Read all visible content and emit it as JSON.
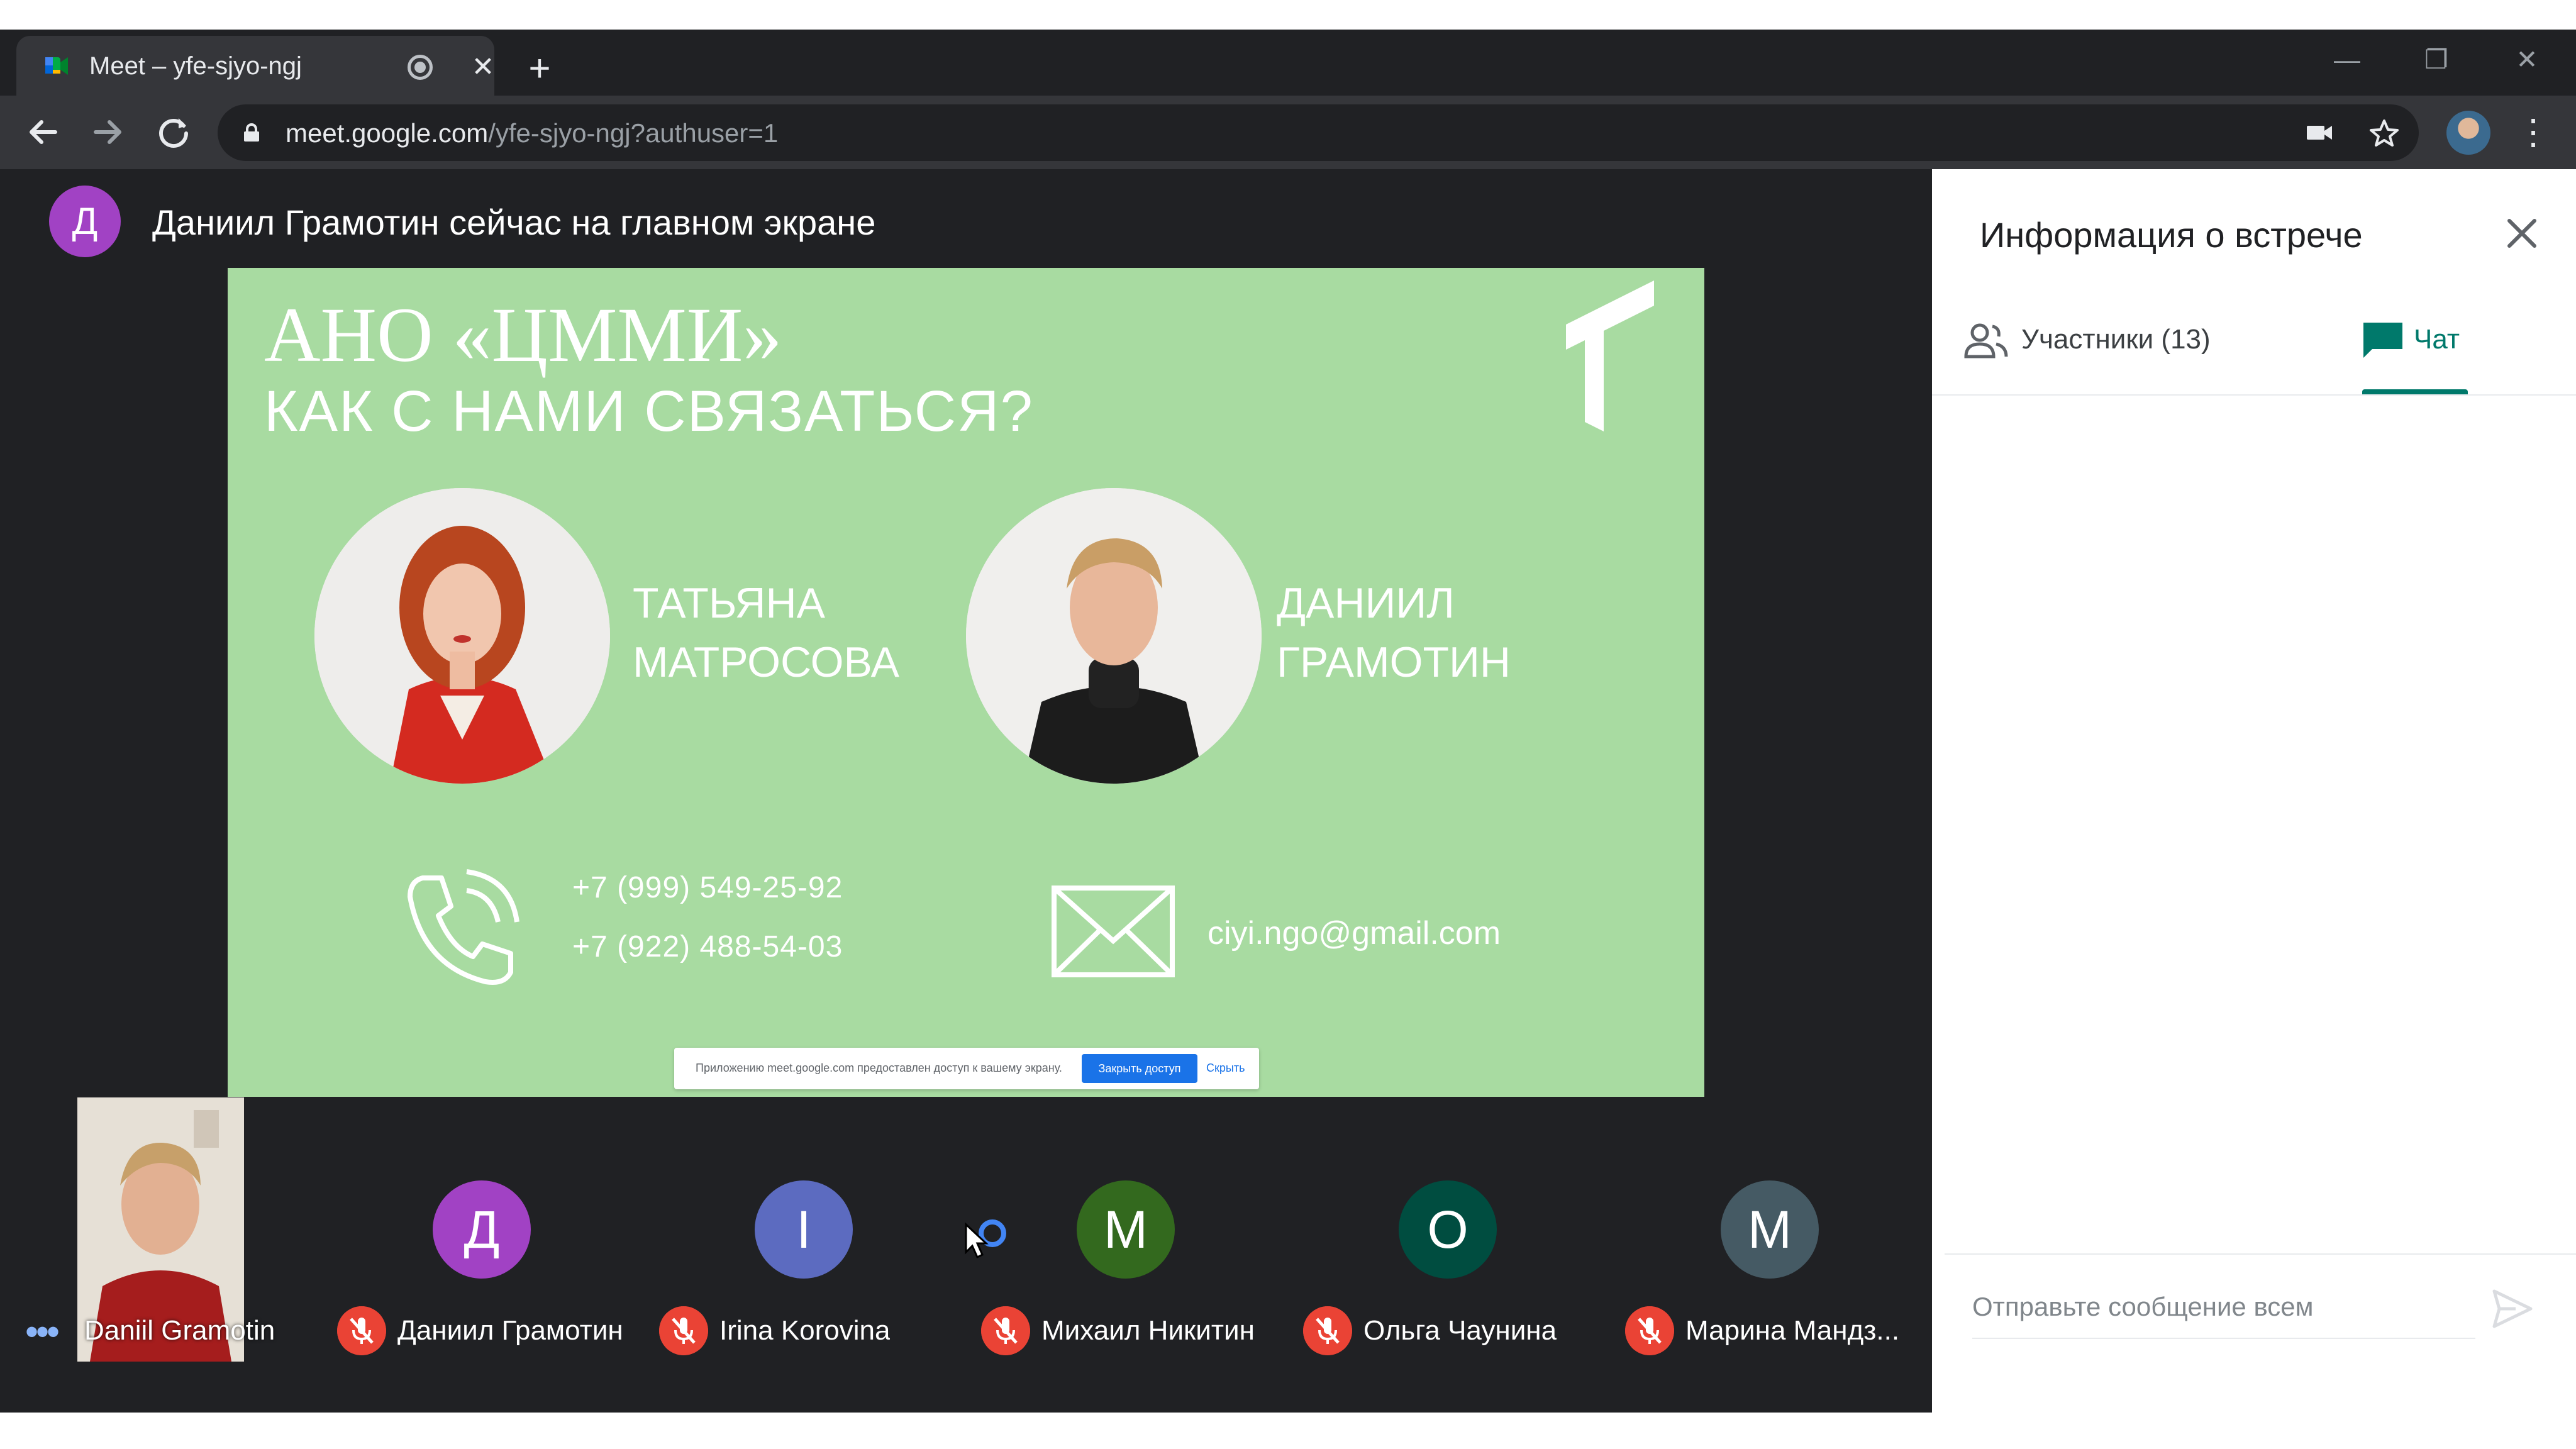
{
  "browser": {
    "tab_title": "Meet – yfe-sjyo-ngj",
    "tab_close": "✕",
    "new_tab": "+",
    "url_host": "meet.google.com",
    "url_path": "/yfe-sjyo-ngj?authuser=1",
    "window_buttons": [
      "—",
      "❐",
      "✕"
    ],
    "menu": "⋮"
  },
  "meet": {
    "presenter_initial": "Д",
    "presenter_text": "Даниил Грамотин сейчас на главном экране",
    "colors": {
      "purple": "#a142c4",
      "indigo": "#5c6bc0",
      "green": "#33691e",
      "teal": "#004d40",
      "slate": "#455a64",
      "mute_red": "#ea4335"
    }
  },
  "slide": {
    "title_line1": "АНО «ЦММИ»",
    "title_line2": "КАК С НАМИ СВЯЗАТЬСЯ?",
    "person1_first": "ТАТЬЯНА",
    "person1_last": "МАТРОСОВА",
    "person2_first": "ДАНИИЛ",
    "person2_last": "ГРАМОТИН",
    "phone1": "+7 (999) 549-25-92",
    "phone2": "+7 (922) 488-54-03",
    "email": "ciyi.ngo@gmail.com",
    "share_notice": "Приложению meet.google.com предоставлен доступ к вашему экрану.",
    "share_stop": "Закрыть доступ",
    "share_hide": "Скрыть"
  },
  "participants": {
    "self_name": "Daniil Gramotin",
    "tiles": [
      {
        "initial": "Д",
        "name": "Даниил Грамотин",
        "color": "#a142c4"
      },
      {
        "initial": "I",
        "name": "Irina Korovina",
        "color": "#5c6bc0"
      },
      {
        "initial": "М",
        "name": "Михаил Никитин",
        "color": "#33691e"
      },
      {
        "initial": "О",
        "name": "Ольга Чаунина",
        "color": "#004d40"
      },
      {
        "initial": "М",
        "name": "Марина Мандз...",
        "color": "#455a64"
      }
    ]
  },
  "panel": {
    "title": "Информация о встрече",
    "tab_people": "Участники (13)",
    "tab_chat": "Чат",
    "chat_placeholder": "Отправьте сообщение всем",
    "accent_color": "#00796b"
  }
}
